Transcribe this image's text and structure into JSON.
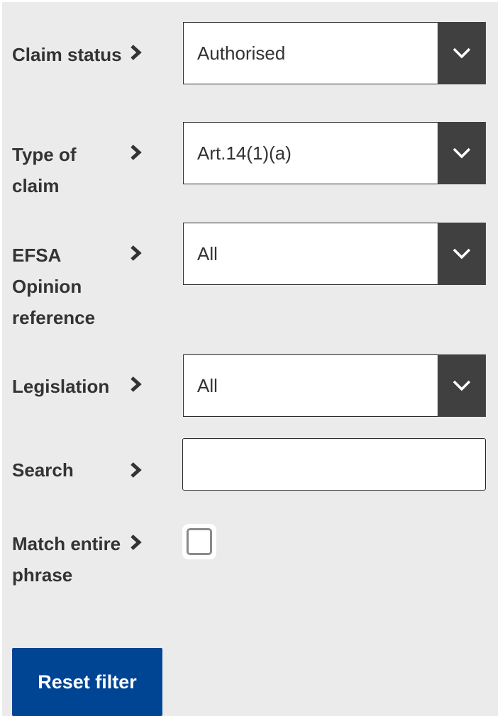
{
  "filters": {
    "claim_status": {
      "label": "Claim status",
      "value": "Authorised"
    },
    "type_of_claim": {
      "label": "Type of claim",
      "value": "Art.14(1)(a)"
    },
    "efsa_opinion": {
      "label": "EFSA Opinion reference",
      "value": "All"
    },
    "legislation": {
      "label": "Legislation",
      "value": "All"
    },
    "search": {
      "label": "Search",
      "value": "",
      "placeholder": ""
    },
    "match_entire_phrase": {
      "label": "Match entire phrase",
      "checked": false
    }
  },
  "actions": {
    "reset_label": "Reset filter"
  },
  "icons": {
    "label_marker": "chevron-right-icon",
    "dropdown": "chevron-down-icon"
  },
  "colors": {
    "panel_background": "#ebebeb",
    "label_text": "#333333",
    "dropdown_button": "#404040",
    "primary_button": "#004494"
  }
}
